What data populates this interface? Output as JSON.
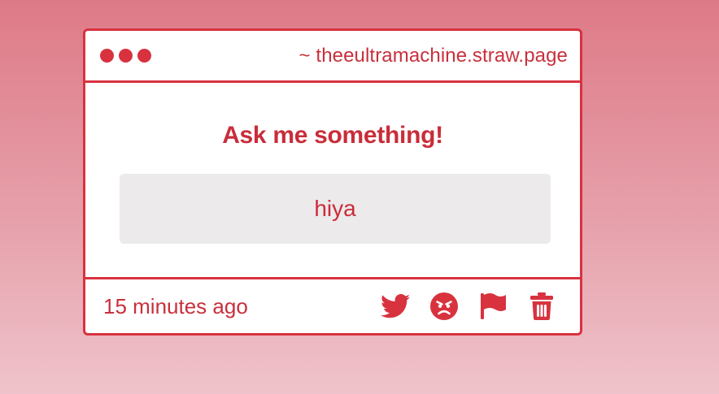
{
  "window": {
    "url": "~ theeultramachine.straw.page"
  },
  "question": {
    "heading": "Ask me something!",
    "answer": "hiya"
  },
  "footer": {
    "timestamp": "15 minutes ago",
    "actions": [
      "twitter-icon",
      "angry-face-icon",
      "flag-icon",
      "trash-icon"
    ]
  },
  "colors": {
    "accent": "#d8323f",
    "answer_bg": "#eceaeb"
  }
}
